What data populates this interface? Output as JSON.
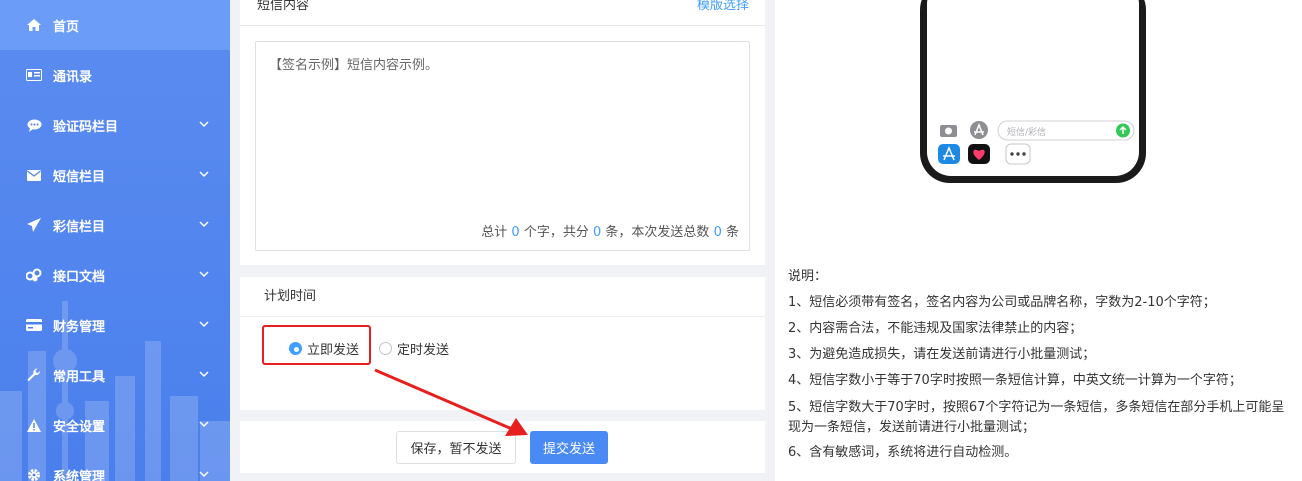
{
  "sidebar": {
    "items": [
      {
        "label": "首页",
        "icon": "home-icon"
      },
      {
        "label": "通讯录",
        "icon": "contact-card-icon"
      },
      {
        "label": "验证码栏目",
        "icon": "chat-bubble-icon"
      },
      {
        "label": "短信栏目",
        "icon": "envelope-icon"
      },
      {
        "label": "彩信栏目",
        "icon": "paper-plane-icon"
      },
      {
        "label": "接口文档",
        "icon": "link-icon"
      },
      {
        "label": "财务管理",
        "icon": "credit-card-icon"
      },
      {
        "label": "常用工具",
        "icon": "wrench-icon"
      },
      {
        "label": "安全设置",
        "icon": "warning-icon"
      },
      {
        "label": "系统管理",
        "icon": "gear-icon"
      }
    ]
  },
  "content": {
    "title": "短信内容",
    "template_link": "模版选择",
    "sample_text": "【签名示例】短信内容示例。",
    "counter": {
      "p1": "总计",
      "chars": "0",
      "p2": "个字，共分",
      "parts": "0",
      "p3": "条，本次发送总数",
      "total": "0",
      "p4": "条"
    }
  },
  "schedule": {
    "title": "计划时间",
    "options": [
      "立即发送",
      "定时发送"
    ],
    "selected": "立即发送"
  },
  "actions": {
    "save_label": "保存，暂不发送",
    "submit_label": "提交发送"
  },
  "preview": {
    "input_placeholder": "短信/彩信"
  },
  "notes": {
    "heading": "说明：",
    "lines": [
      "1、短信必须带有签名，签名内容为公司或品牌名称，字数为2-10个字符；",
      "2、内容需合法，不能违规及国家法律禁止的内容；",
      "3、为避免造成损失，请在发送前请进行小批量测试；",
      "4、短信字数小于等于70字时按照一条短信计算，中英文统一计算为一个字符；",
      "5、短信字数大于70字时，按照67个字符记为一条短信，多条短信在部分手机上可能呈现为一条短信，发送前请进行小批量测试；",
      "6、含有敏感词，系统将进行自动检测。"
    ]
  },
  "colors": {
    "sidebar": "#4a7fec",
    "accent": "#409eff",
    "highlight": "#e81f1f",
    "submit": "#4a8af4"
  }
}
